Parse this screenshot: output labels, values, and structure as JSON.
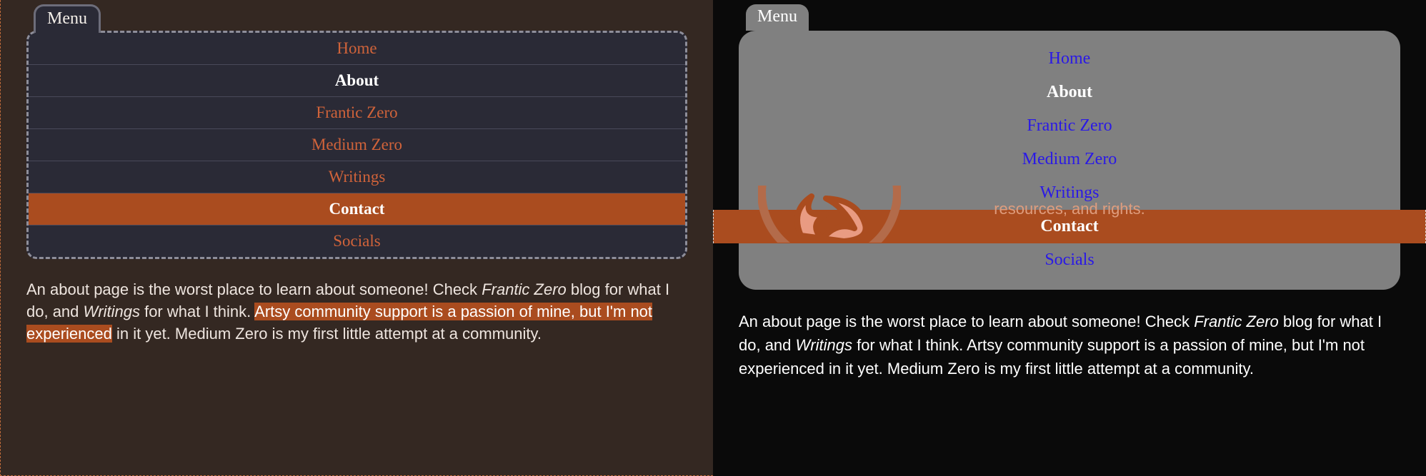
{
  "left": {
    "menu_label": "Menu",
    "nav": {
      "home": "Home",
      "about": "About",
      "frantic": "Frantic Zero",
      "medium": "Medium Zero",
      "writings": "Writings",
      "contact": "Contact",
      "socials": "Socials"
    },
    "body": {
      "t1": "An about page is the worst place to learn about someone! Check ",
      "i1": "Frantic Zero",
      "t2": " blog for what I do, and ",
      "i2": "Writings",
      "t3": " for what I think. ",
      "s1": "Artsy community support is a passion of mine, but I'm not experienced",
      "t4": " in it yet. Medium Zero is my first little attempt at a community."
    }
  },
  "right": {
    "menu_label": "Menu",
    "nav": {
      "home": "Home",
      "about": "About",
      "frantic": "Frantic Zero",
      "medium": "Medium Zero",
      "writings": "Writings",
      "contact": "Contact",
      "socials": "Socials"
    },
    "peek_text": "resources, and rights.",
    "body": {
      "t1": "An about page is the worst place to learn about someone! Check ",
      "i1": "Frantic Zero",
      "t2": " blog for what I do, and ",
      "i2": "Writings",
      "t3": " for what I think. Artsy community support is a passion of mine, but I'm not experienced in it yet. Medium Zero is my first little attempt at a community."
    }
  }
}
